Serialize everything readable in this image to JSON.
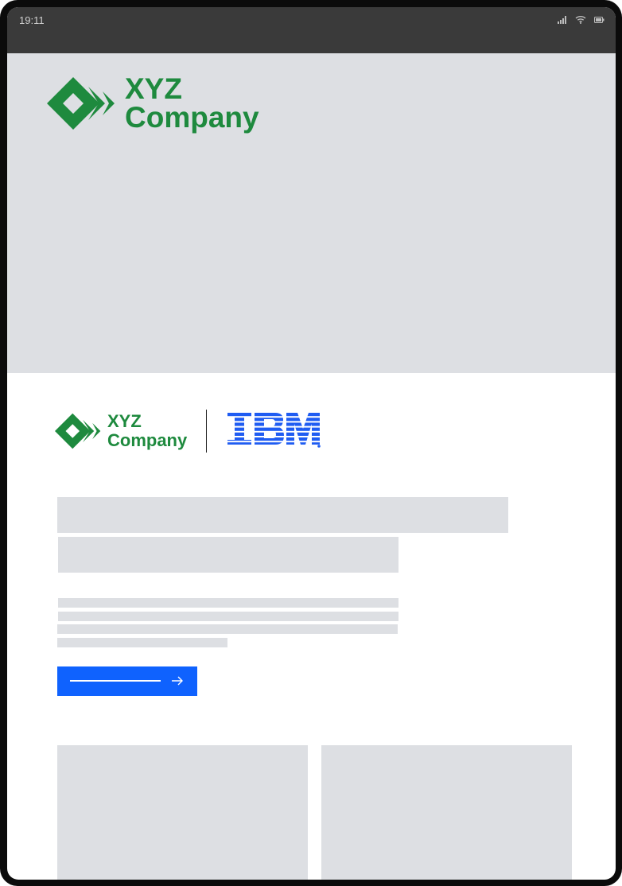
{
  "status_bar": {
    "time": "19:11",
    "icons": [
      "signal-icon",
      "wifi-icon",
      "battery-icon"
    ]
  },
  "hero": {
    "logo": {
      "line1": "XYZ",
      "line2": "Company"
    }
  },
  "cobrand": {
    "partner_logo": {
      "line1": "XYZ",
      "line2": "Company"
    },
    "ibm_logo": "IBM"
  },
  "cta": {
    "icon": "arrow-right-icon"
  },
  "colors": {
    "brand_green": "#1e8a3e",
    "ibm_blue": "#0f62fe",
    "placeholder_gray": "#dddfe3",
    "status_bar": "#3a3a3a"
  }
}
